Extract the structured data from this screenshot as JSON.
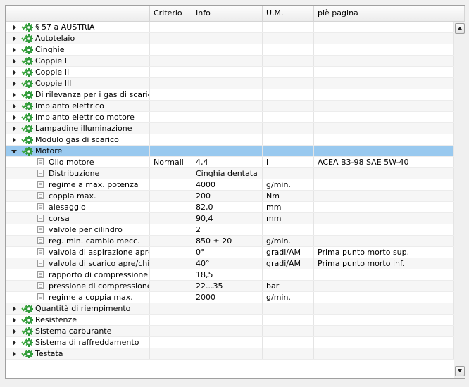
{
  "columns": [
    "",
    "Criterio",
    "Info",
    "U.M.",
    "piè pagina"
  ],
  "rows": [
    {
      "label": "§ 57 a AUSTRIA",
      "kind": "group",
      "expanded": false
    },
    {
      "label": "Autotelaio",
      "kind": "group",
      "expanded": false
    },
    {
      "label": "Cinghie",
      "kind": "group",
      "expanded": false
    },
    {
      "label": "Coppie I",
      "kind": "group",
      "expanded": false
    },
    {
      "label": "Coppie II",
      "kind": "group",
      "expanded": false
    },
    {
      "label": "Coppie III",
      "kind": "group",
      "expanded": false
    },
    {
      "label": "Di rilevanza per i gas di scarico",
      "kind": "group",
      "expanded": false
    },
    {
      "label": "Impianto elettrico",
      "kind": "group",
      "expanded": false
    },
    {
      "label": "Impianto elettrico motore",
      "kind": "group",
      "expanded": false
    },
    {
      "label": "Lampadine illuminazione",
      "kind": "group",
      "expanded": false
    },
    {
      "label": "Modulo gas di scarico",
      "kind": "group",
      "expanded": false
    },
    {
      "label": "Motore",
      "kind": "group",
      "expanded": true,
      "selected": true
    },
    {
      "label": "Olio motore",
      "kind": "item",
      "criterio": "Normali",
      "info": "4,4",
      "um": "l",
      "pie": "ACEA B3-98 SAE 5W-40"
    },
    {
      "label": "Distribuzione",
      "kind": "item",
      "criterio": "",
      "info": "Cinghia dentata",
      "um": "",
      "pie": ""
    },
    {
      "label": "regime a max. potenza",
      "kind": "item",
      "criterio": "",
      "info": "4000",
      "um": "g/min.",
      "pie": ""
    },
    {
      "label": "coppia max.",
      "kind": "item",
      "criterio": "",
      "info": "200",
      "um": "Nm",
      "pie": ""
    },
    {
      "label": "alesaggio",
      "kind": "item",
      "criterio": "",
      "info": "82,0",
      "um": "mm",
      "pie": ""
    },
    {
      "label": "corsa",
      "kind": "item",
      "criterio": "",
      "info": "90,4",
      "um": "mm",
      "pie": ""
    },
    {
      "label": "valvole per cilindro",
      "kind": "item",
      "criterio": "",
      "info": "2",
      "um": "",
      "pie": ""
    },
    {
      "label": "reg. min. cambio mecc.",
      "kind": "item",
      "criterio": "",
      "info": "850 ± 20",
      "um": "g/min.",
      "pie": ""
    },
    {
      "label": "valvola di aspirazione apre/",
      "kind": "item",
      "criterio": "",
      "info": "0°",
      "um": "gradi/AM",
      "pie": "Prima punto morto sup."
    },
    {
      "label": "valvola di scarico apre/chiu",
      "kind": "item",
      "criterio": "",
      "info": "40°",
      "um": "gradi/AM",
      "pie": "Prima punto morto inf."
    },
    {
      "label": "rapporto di compressione",
      "kind": "item",
      "criterio": "",
      "info": "18,5",
      "um": "",
      "pie": ""
    },
    {
      "label": "pressione di compressione",
      "kind": "item",
      "criterio": "",
      "info": "22...35",
      "um": "bar",
      "pie": ""
    },
    {
      "label": "regime a coppia max.",
      "kind": "item",
      "criterio": "",
      "info": "2000",
      "um": "g/min.",
      "pie": ""
    },
    {
      "label": "Quantità di riempimento",
      "kind": "group",
      "expanded": false
    },
    {
      "label": "Resistenze",
      "kind": "group",
      "expanded": false
    },
    {
      "label": "Sistema carburante",
      "kind": "group",
      "expanded": false
    },
    {
      "label": "Sistema di raffreddamento",
      "kind": "group",
      "expanded": false
    },
    {
      "label": "Testata",
      "kind": "group",
      "expanded": false
    }
  ],
  "colors": {
    "selected": "#99c9ef",
    "gear": "#2f9a3a",
    "check": "#3aa53a"
  }
}
